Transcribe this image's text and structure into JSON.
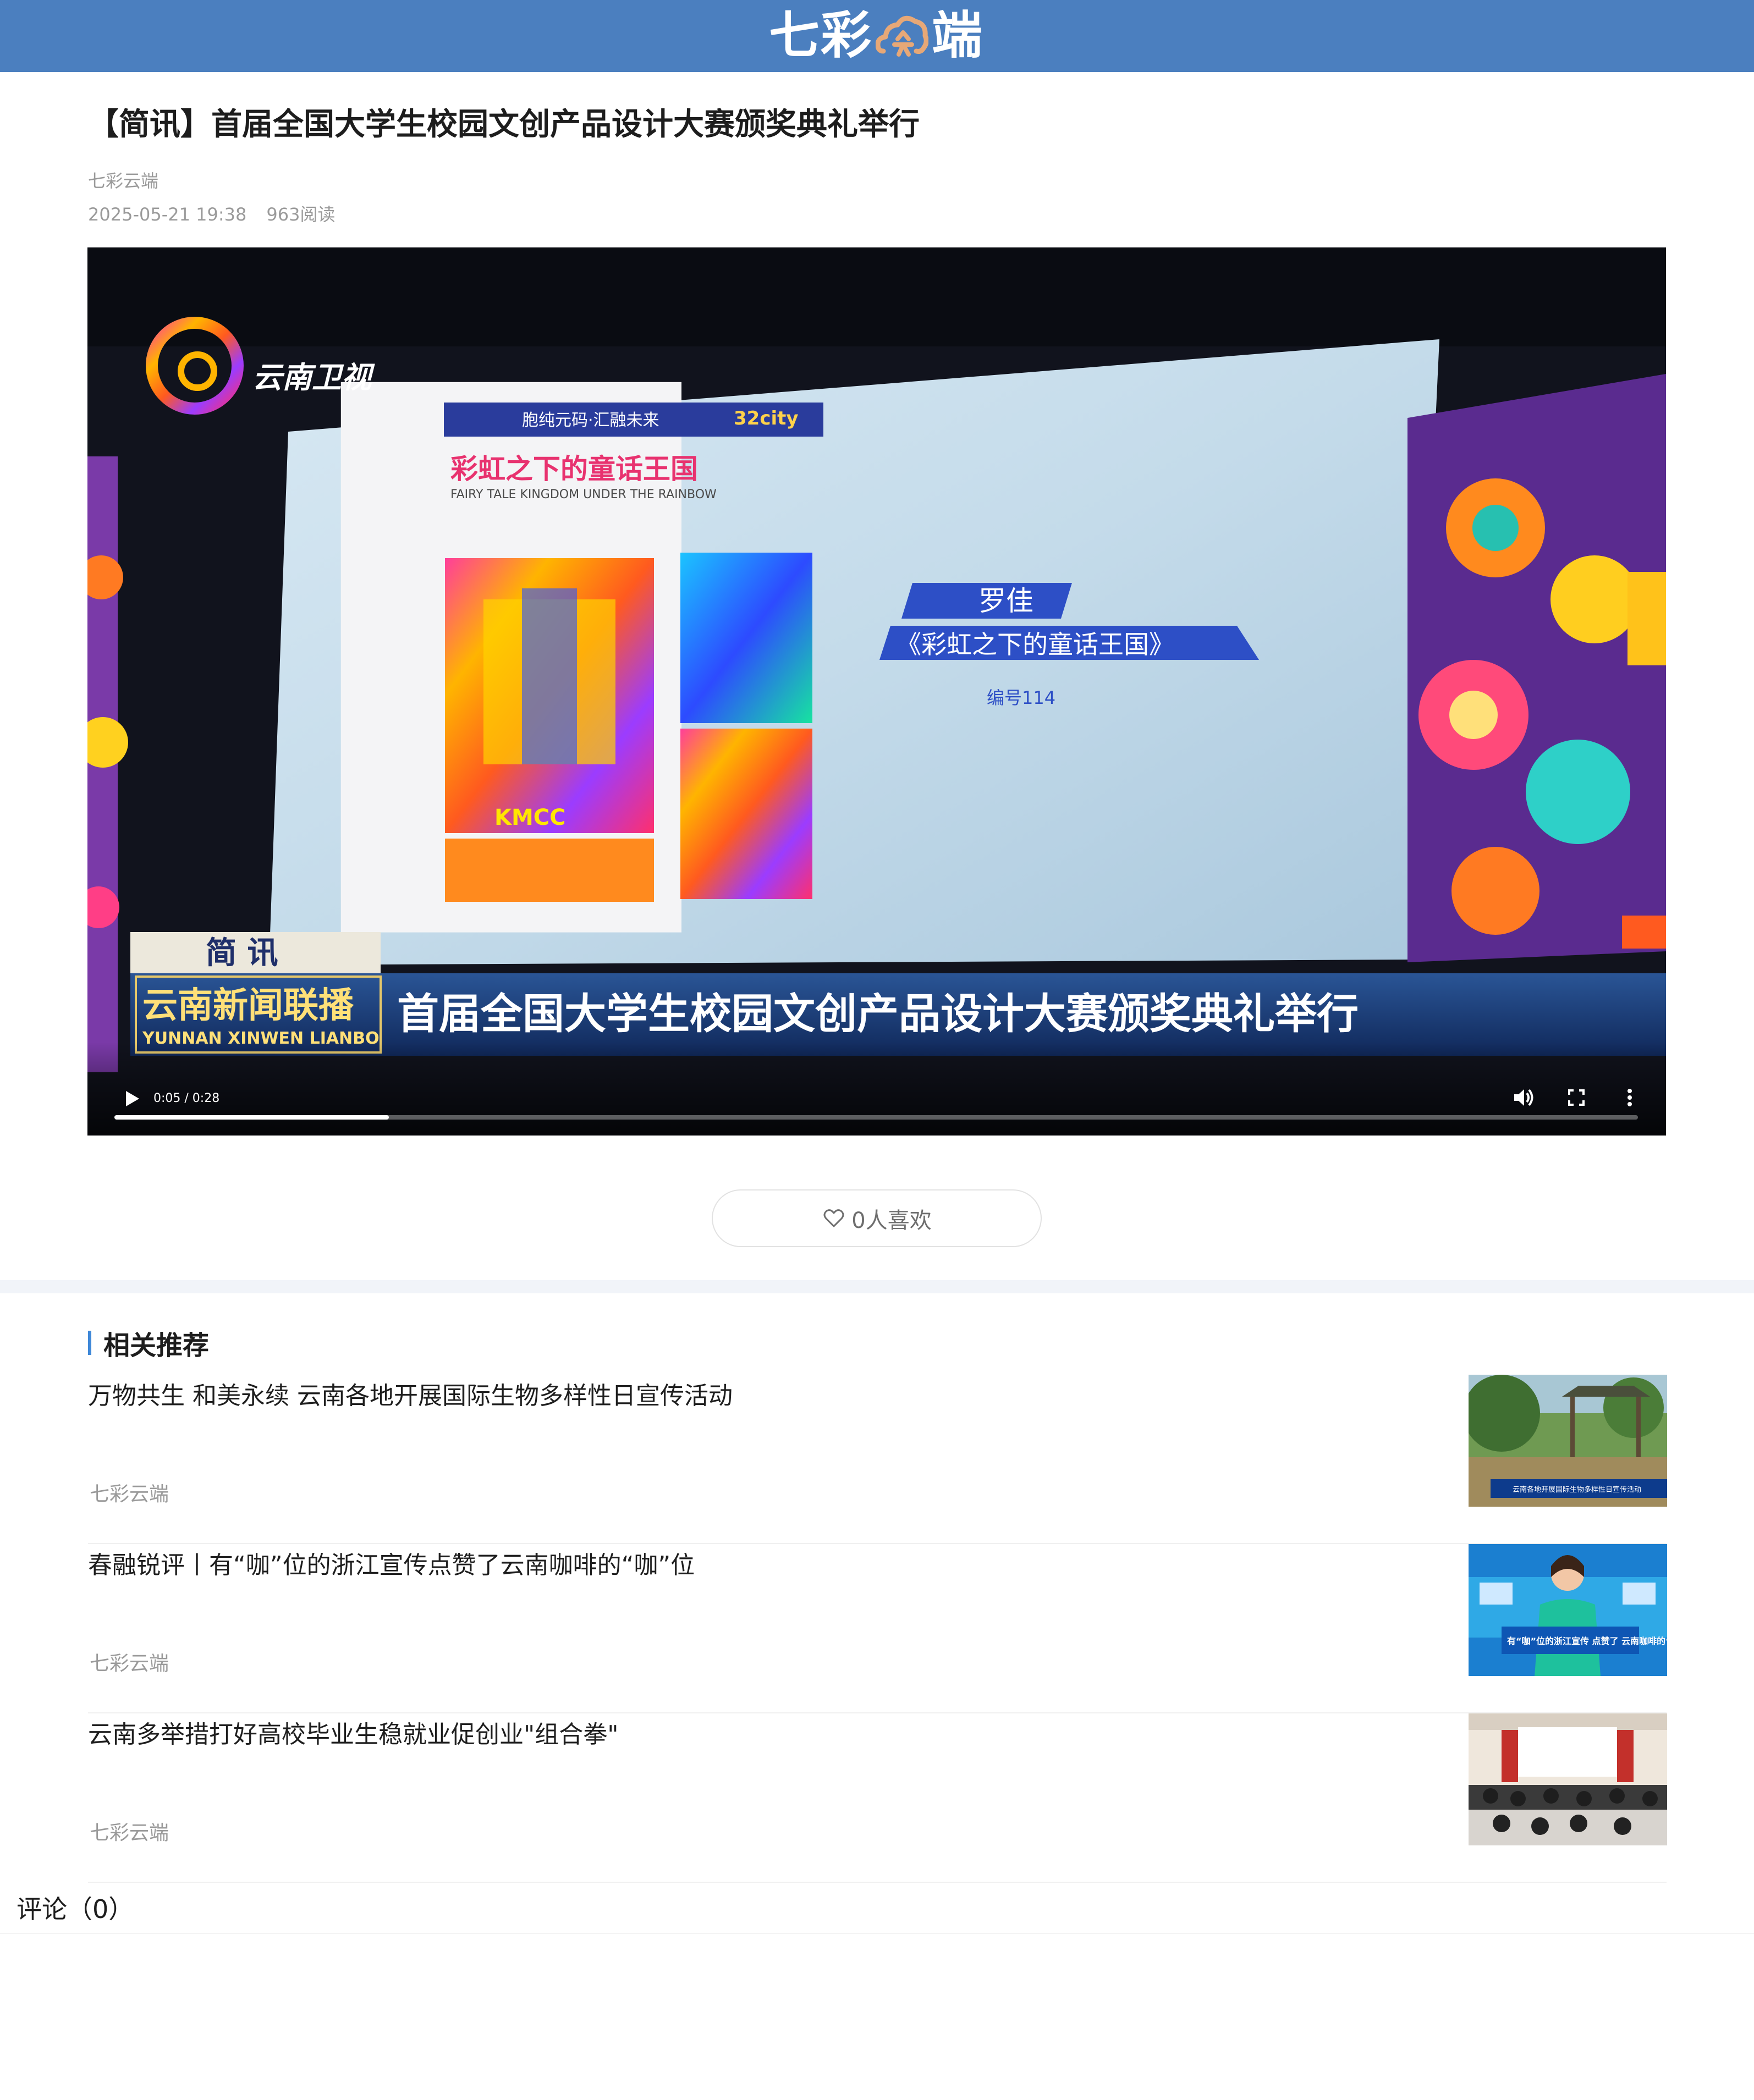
{
  "header": {
    "logo_left": "七彩",
    "logo_right": "端",
    "brand_color": "#4b7fbf",
    "logo_cloud_color": "#e7a877"
  },
  "article": {
    "title": "【简讯】首届全国大学生校园文创产品设计大赛颁奖典礼举行",
    "source": "七彩云端",
    "date": "2025-05-21 19:38",
    "reads": "963阅读"
  },
  "video": {
    "station_logo": "云南卫视",
    "poster_header": "胞纯元码·汇融未来",
    "poster_badge": "32city",
    "poster_title": "彩虹之下的童话王国",
    "poster_subtitle": "FAIRY TALE KINGDOM UNDER THE RAINBOW",
    "poster_kmcc": "KMCC",
    "winner_name": "罗佳",
    "winner_work": "《彩虹之下的童话王国》",
    "winner_number": "编号114",
    "program_tag": "简 讯",
    "program_name": "云南新闻联播",
    "program_pinyin": "YUNNAN XINWEN LIANBO",
    "caption": "首届全国大学生校园文创产品设计大赛颁奖典礼举行",
    "time_display": "0:05 / 0:28",
    "played_fraction": 0.18,
    "icons": [
      "play-icon",
      "volume-icon",
      "fullscreen-icon",
      "more-vertical-icon"
    ]
  },
  "like": {
    "label": "0人喜欢",
    "icon": "heart-outline-icon"
  },
  "related": {
    "title": "相关推荐",
    "accent": "#3f88d8",
    "items": [
      {
        "title": "万物共生 和美永续 云南各地开展国际生物多样性日宣传活动",
        "source": "七彩云端",
        "thumb_caption": "云南各地开展国际生物多样性日宣传活动"
      },
      {
        "title": "春融锐评丨有“咖”位的浙江宣传点赞了云南咖啡的“咖”位",
        "source": "七彩云端",
        "thumb_caption": "有“咖”位的浙江宣传 点赞了 云南咖啡的“咖”位"
      },
      {
        "title": "云南多举措打好高校毕业生稳就业促创业\"组合拳\"",
        "source": "七彩云端",
        "thumb_caption": ""
      }
    ]
  },
  "comments": {
    "label": "评论（0）"
  }
}
